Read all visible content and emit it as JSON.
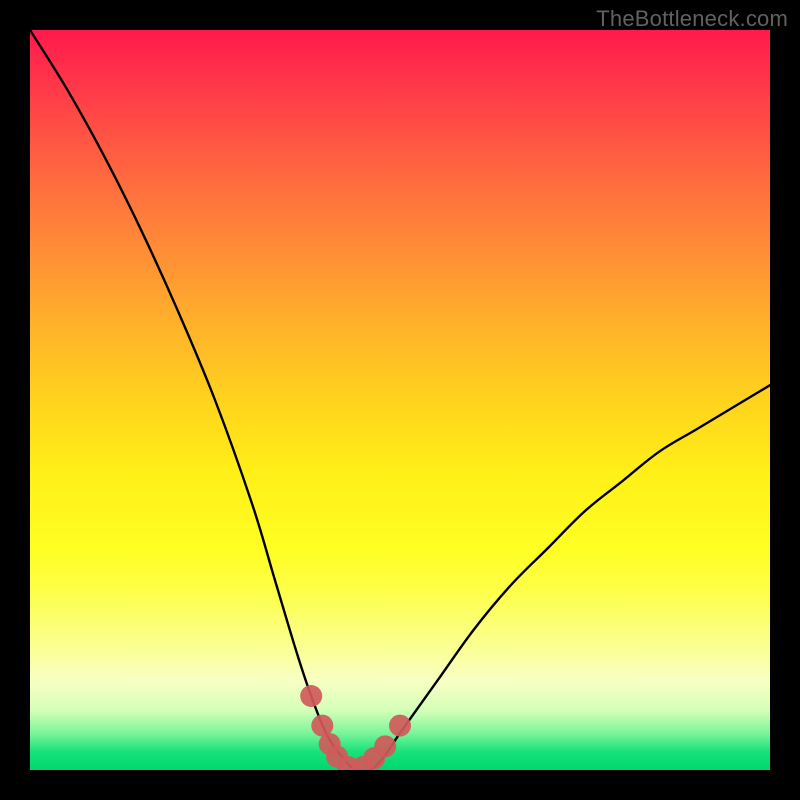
{
  "watermark": "TheBottleneck.com",
  "colors": {
    "background": "#000000",
    "gradient_top": "#ff1a4c",
    "gradient_mid": "#fff018",
    "gradient_bottom": "#00d76f",
    "curve": "#000000",
    "marker": "#d05a5a"
  },
  "chart_data": {
    "type": "line",
    "title": "",
    "xlabel": "",
    "ylabel": "",
    "xlim": [
      0,
      100
    ],
    "ylim": [
      0,
      100
    ],
    "grid": false,
    "legend": false,
    "series": [
      {
        "name": "bottleneck-curve",
        "x": [
          0,
          5,
          10,
          15,
          20,
          25,
          30,
          33,
          36,
          38,
          40,
          42,
          44,
          46,
          48,
          50,
          55,
          60,
          65,
          70,
          75,
          80,
          85,
          90,
          95,
          100
        ],
        "values": [
          100,
          92,
          83,
          73,
          62,
          50,
          36,
          26,
          16,
          10,
          5,
          2,
          0,
          0,
          2,
          5,
          12,
          19,
          25,
          30,
          35,
          39,
          43,
          46,
          49,
          52
        ]
      }
    ],
    "markers": {
      "name": "highlight-dots",
      "x": [
        38,
        39.5,
        40.5,
        41.5,
        43,
        45,
        46.5,
        48,
        50
      ],
      "values": [
        10,
        6,
        3.5,
        1.8,
        0.4,
        0.4,
        1.6,
        3.2,
        6
      ],
      "radius": 11
    }
  }
}
